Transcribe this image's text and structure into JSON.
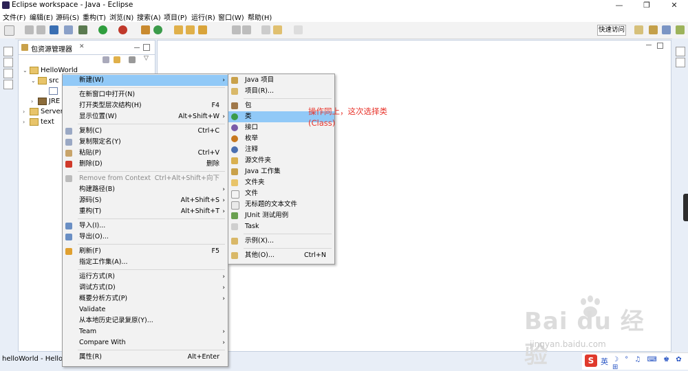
{
  "window": {
    "title": "Eclipse workspace - Java - Eclipse",
    "minimize": "—",
    "restore": "❐",
    "close": "✕"
  },
  "menu": [
    "文件(F)",
    "编辑(E)",
    "源码(S)",
    "重构(T)",
    "浏览(N)",
    "搜索(A)",
    "项目(P)",
    "运行(R)",
    "窗口(W)",
    "帮助(H)"
  ],
  "toolbar": {
    "quick_access": "快速访问"
  },
  "package_explorer": {
    "tab_label": "包资源管理器",
    "tab_close": "✕",
    "tree": [
      {
        "label": "HelloWorld",
        "twisty": "⌄",
        "depth": 0
      },
      {
        "label": "src",
        "twisty": "⌄",
        "depth": 1
      },
      {
        "label": "",
        "twisty": "",
        "depth": 2
      },
      {
        "label": "JRE",
        "twisty": "›",
        "depth": 1
      },
      {
        "label": "Server",
        "twisty": "›",
        "depth": 0
      },
      {
        "label": "text",
        "twisty": "›",
        "depth": 0
      }
    ]
  },
  "status": {
    "text": "helloWorld - HelloW"
  },
  "context_menu": {
    "items": [
      {
        "label": "新建(W)",
        "submenu": true,
        "highlighted": true
      },
      {
        "sep": true
      },
      {
        "label": "在新窗口中打开(N)"
      },
      {
        "label": "打开类型层次结构(H)",
        "shortcut": "F4"
      },
      {
        "label": "显示位置(W)",
        "shortcut": "Alt+Shift+W",
        "submenu": true
      },
      {
        "sep": true
      },
      {
        "label": "复制(C)",
        "shortcut": "Ctrl+C",
        "icon": "copy-icon"
      },
      {
        "label": "复制限定名(Y)",
        "icon": "copy-qualified-icon"
      },
      {
        "label": "粘贴(P)",
        "shortcut": "Ctrl+V",
        "icon": "paste-icon"
      },
      {
        "label": "删除(D)",
        "shortcut": "删除",
        "icon": "delete-icon"
      },
      {
        "sep": true
      },
      {
        "label": "Remove from Context",
        "shortcut": "Ctrl+Alt+Shift+向下",
        "disabled": true,
        "icon": "remove-context-icon"
      },
      {
        "label": "构建路径(B)",
        "submenu": true
      },
      {
        "label": "源码(S)",
        "shortcut": "Alt+Shift+S",
        "submenu": true
      },
      {
        "label": "重构(T)",
        "shortcut": "Alt+Shift+T",
        "submenu": true
      },
      {
        "sep": true
      },
      {
        "label": "导入(I)...",
        "icon": "import-icon"
      },
      {
        "label": "导出(O)...",
        "icon": "export-icon"
      },
      {
        "sep": true
      },
      {
        "label": "刷新(F)",
        "shortcut": "F5",
        "icon": "refresh-icon"
      },
      {
        "label": "指定工作集(A)..."
      },
      {
        "sep": true
      },
      {
        "label": "运行方式(R)",
        "submenu": true
      },
      {
        "label": "调试方式(D)",
        "submenu": true
      },
      {
        "label": "概要分析方式(P)",
        "submenu": true
      },
      {
        "label": "Validate"
      },
      {
        "label": "从本地历史记录复原(Y)..."
      },
      {
        "label": "Team",
        "submenu": true
      },
      {
        "label": "Compare With",
        "submenu": true
      },
      {
        "sep": true
      },
      {
        "label": "属性(R)",
        "shortcut": "Alt+Enter"
      }
    ]
  },
  "new_submenu": {
    "items": [
      {
        "label": "Java 项目",
        "icon": "java-project-icon"
      },
      {
        "label": "项目(R)...",
        "icon": "project-icon"
      },
      {
        "sep": true
      },
      {
        "label": "包",
        "icon": "package-icon"
      },
      {
        "label": "类",
        "icon": "class-icon",
        "highlighted": true
      },
      {
        "label": "接口",
        "icon": "interface-icon"
      },
      {
        "label": "枚举",
        "icon": "enum-icon"
      },
      {
        "label": "注释",
        "icon": "annotation-icon"
      },
      {
        "label": "源文件夹",
        "icon": "source-folder-icon"
      },
      {
        "label": "Java 工作集",
        "icon": "working-set-icon"
      },
      {
        "label": "文件夹",
        "icon": "folder-icon"
      },
      {
        "label": "文件",
        "icon": "file-icon"
      },
      {
        "label": "无标题的文本文件",
        "icon": "untitled-text-icon"
      },
      {
        "label": "JUnit 测试用例",
        "icon": "junit-icon"
      },
      {
        "label": "Task",
        "icon": "task-icon"
      },
      {
        "sep": true
      },
      {
        "label": "示例(X)...",
        "icon": "example-icon"
      },
      {
        "sep": true
      },
      {
        "label": "其他(O)...",
        "shortcut": "Ctrl+N",
        "icon": "other-icon"
      }
    ]
  },
  "annotation": {
    "text": "操作同上，这次选择类(Class)"
  },
  "watermark": {
    "brand": "Bai du 经验",
    "url": "jingyan.baidu.com"
  },
  "ime": {
    "logo": "S",
    "lang": "英",
    "icons": "☽ ° ♫ ⌨ ♚ ✿ ⊞"
  },
  "colors": {
    "highlight": "#91c9f7",
    "annotation": "#e8332a",
    "menu_bg": "#f2f2f2"
  }
}
